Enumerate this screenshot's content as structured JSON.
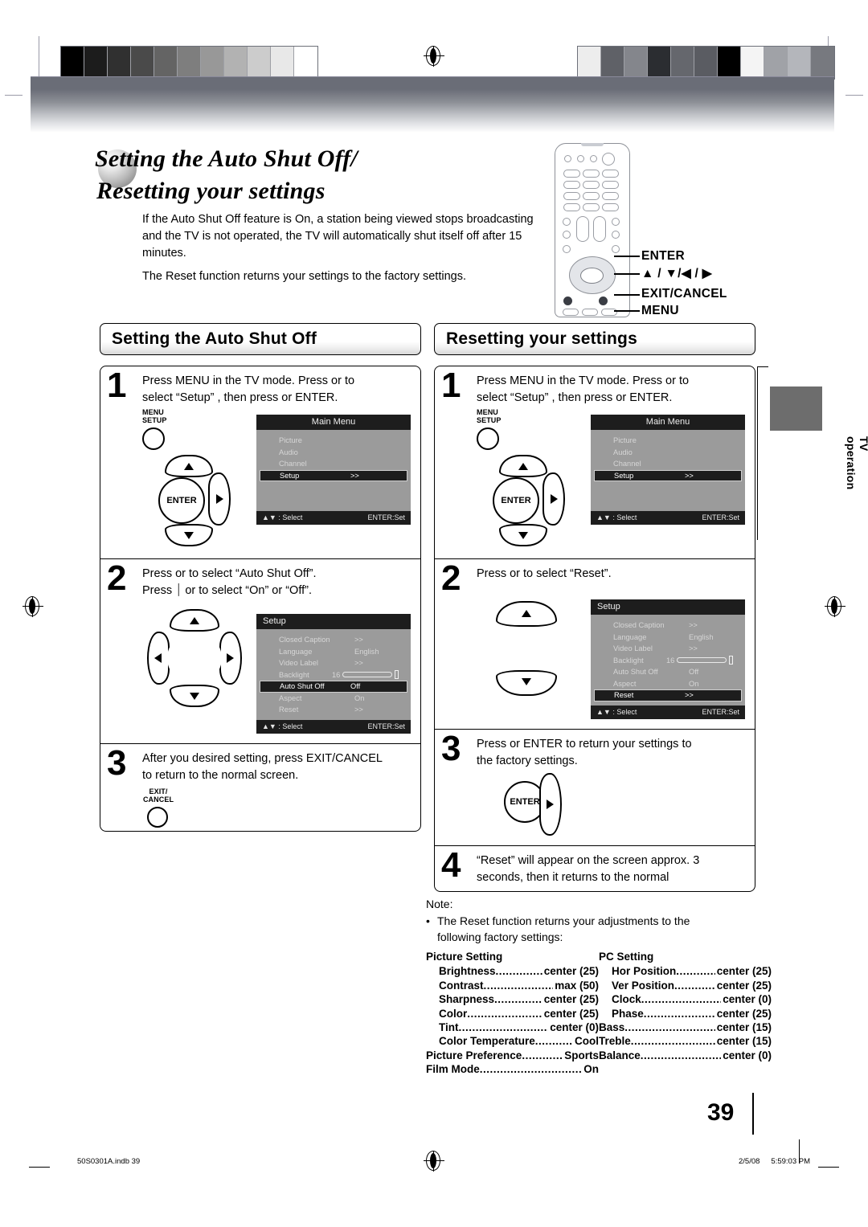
{
  "page": {
    "number": "39",
    "side_tab": "TV operation"
  },
  "title": {
    "line1": "Setting the Auto Shut Off/",
    "line2": "Resetting your settings"
  },
  "intro": {
    "paragraph1": "If the Auto Shut Off feature is On, a station being viewed stops broadcasting and the TV is not operated, the TV will automatically shut itself off after 15 minutes.",
    "paragraph2": "The Reset function returns your settings to the factory settings."
  },
  "remote_callouts": {
    "enter": "ENTER",
    "dpad": "▲ / ▼/◀ / ▶",
    "exit_cancel": "EXIT/CANCEL",
    "menu": "MENU"
  },
  "sections": {
    "left": {
      "heading": "Setting the Auto Shut Off",
      "steps": [
        {
          "num": "1",
          "line1": "Press MENU in the TV mode. Press          or        to",
          "line2": "select “Setup” , then press            or ENTER.",
          "key_label_line1": "MENU",
          "key_label_line2": "SETUP",
          "enter_label": "ENTER"
        },
        {
          "num": "2",
          "line1": "Press      or      to select “Auto Shut Off”.",
          "line2": "Press  ⏐ or      to select “On” or “Off”."
        },
        {
          "num": "3",
          "line1": "After you desired setting, press EXIT/CANCEL",
          "line2": "to return to the normal screen.",
          "key_label_line1": "EXIT/",
          "key_label_line2": "CANCEL"
        }
      ]
    },
    "right": {
      "heading": "Resetting your settings",
      "steps": [
        {
          "num": "1",
          "line1": "Press MENU in the TV mode. Press          or        to",
          "line2": "select “Setup” , then press            or ENTER.",
          "key_label_line1": "MENU",
          "key_label_line2": "SETUP",
          "enter_label": "ENTER"
        },
        {
          "num": "2",
          "line1": "Press      or      to select “Reset”.",
          "line2": ""
        },
        {
          "num": "3",
          "line1": "Press       or ENTER to return your settings to",
          "line2": "the factory settings.",
          "enter_label": "ENTER"
        },
        {
          "num": "4",
          "line1": "“Reset” will appear on the screen approx. 3",
          "line2": "seconds, then it returns to the normal"
        }
      ]
    }
  },
  "osd_main_menu": {
    "title": "Main Menu",
    "items": [
      {
        "label": "Picture",
        "value": "",
        "highlight": false
      },
      {
        "label": "Audio",
        "value": "",
        "highlight": false
      },
      {
        "label": "Channel",
        "value": "",
        "highlight": false
      },
      {
        "label": "Setup",
        "value": ">>",
        "highlight": true
      }
    ],
    "footer_left": "▲▼ : Select",
    "footer_right": "ENTER:Set"
  },
  "osd_setup_autoshutoff": {
    "title": "Setup",
    "items": [
      {
        "label": "Closed Caption",
        "value": ">>",
        "highlight": false
      },
      {
        "label": "Language",
        "value": "English",
        "highlight": false
      },
      {
        "label": "Video Label",
        "value": ">>",
        "highlight": false
      },
      {
        "label": "Backlight",
        "value": "16",
        "slider": true,
        "highlight": false
      },
      {
        "label": "Auto Shut Off",
        "value": "Off",
        "highlight": true
      },
      {
        "label": "Aspect",
        "value": "On",
        "highlight": false
      },
      {
        "label": "Reset",
        "value": ">>",
        "highlight": false
      }
    ],
    "footer_left": "▲▼ : Select",
    "footer_right": "ENTER:Set"
  },
  "osd_setup_reset": {
    "title": "Setup",
    "items": [
      {
        "label": "Closed Caption",
        "value": ">>",
        "highlight": false
      },
      {
        "label": "Language",
        "value": "English",
        "highlight": false
      },
      {
        "label": "Video Label",
        "value": ">>",
        "highlight": false
      },
      {
        "label": "Backlight",
        "value": "16",
        "slider": true,
        "highlight": false
      },
      {
        "label": "Auto Shut Off",
        "value": "Off",
        "highlight": false
      },
      {
        "label": "Aspect",
        "value": "On",
        "highlight": false
      },
      {
        "label": "Reset",
        "value": ">>",
        "highlight": true
      }
    ],
    "footer_left": "▲▼ : Select",
    "footer_right": "ENTER:Set"
  },
  "note": {
    "heading": "Note:",
    "bullet": "•",
    "text_line1": "The Reset function returns your adjustments to the",
    "text_line2": "following factory settings:"
  },
  "factory_settings": {
    "left_column": {
      "header": "Picture Setting",
      "rows": [
        {
          "name": "Brightness",
          "value": "center (25)",
          "indent": true
        },
        {
          "name": "Contrast",
          "value": "max (50)",
          "indent": true
        },
        {
          "name": "Sharpness",
          "value": "center (25)",
          "indent": true
        },
        {
          "name": "Color",
          "value": "center (25)",
          "indent": true
        },
        {
          "name": "Tint",
          "value": "center (0)",
          "indent": true
        },
        {
          "name": "Color Temperature",
          "value": "Cool",
          "indent": true
        },
        {
          "name": "Picture Preference",
          "value": "Sports",
          "indent": false
        },
        {
          "name": "Film Mode",
          "value": "On",
          "indent": false
        }
      ]
    },
    "right_column": {
      "header": "PC Setting",
      "rows": [
        {
          "name": "Hor Position",
          "value": "center (25)",
          "indent": true
        },
        {
          "name": "Ver Position",
          "value": "center (25)",
          "indent": true
        },
        {
          "name": "Clock",
          "value": "center (0)",
          "indent": true
        },
        {
          "name": "Phase",
          "value": "center (25)",
          "indent": true
        },
        {
          "name": "Bass",
          "value": "center (15)",
          "indent": false
        },
        {
          "name": "Treble",
          "value": "center (15)",
          "indent": false
        },
        {
          "name": "Balance",
          "value": "center (0)",
          "indent": false
        }
      ]
    }
  },
  "footer": {
    "file": "50S0301A.indb   39",
    "date": "2/5/08",
    "time": "5:59:03 PM"
  },
  "colors": {
    "osd_body": "#9b9b9b",
    "osd_bar": "#1d1d1d",
    "side_tab_swatch": "#6d6d6d"
  },
  "calibration": {
    "left_swatches": [
      "#000000",
      "#1c1c1c",
      "#303030",
      "#4a4a4a",
      "#646464",
      "#7e7e7e",
      "#989898",
      "#b2b2b2",
      "#cccccc",
      "#e8e8e8",
      "#ffffff"
    ],
    "right_swatches": [
      "#ededed",
      "#5f6167",
      "#84868c",
      "#2b2d31",
      "#65676d",
      "#5a5c62",
      "#000000",
      "#f4f4f4",
      "#a0a2a7",
      "#b4b6bb",
      "#77797f"
    ]
  }
}
